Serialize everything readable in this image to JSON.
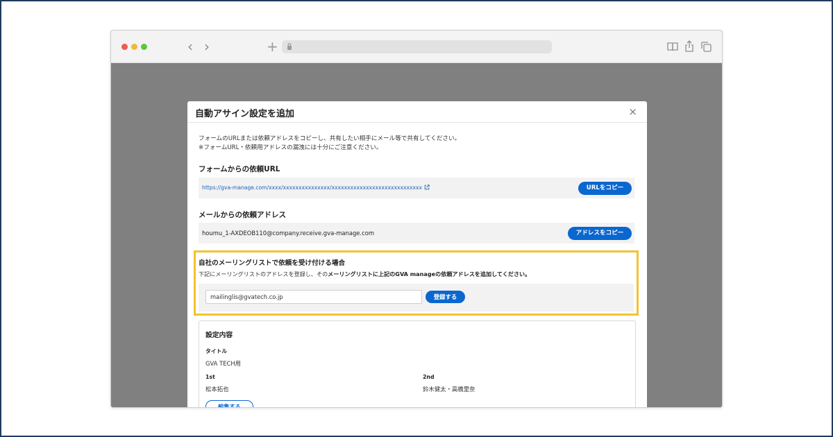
{
  "modal": {
    "title": "自動アサイン設定を追加",
    "close_label": "×",
    "intro_line1": "フォームのURLまたは依頼アドレスをコピーし、共有したい相手にメール等で共有してください。",
    "intro_line2": "※フォームURL・依頼用アドレスの漏洩には十分にご注意ください。"
  },
  "form_url_section": {
    "title": "フォームからの依頼URL",
    "url": "https://gva-manage.com/xxxx/xxxxxxxxxxxxxxx/xxxxxxxxxxxxxxxxxxxxxxxxxxxxx",
    "copy_button": "URLをコピー"
  },
  "mail_section": {
    "title": "メールからの依頼アドレス",
    "address": "houmu_1-AXDEOB110@company.receive.gva-manage.com",
    "copy_button": "アドレスをコピー"
  },
  "mailing_list": {
    "title": "自社のメーリングリストで依頼を受け付ける場合",
    "desc_plain": "下記にメーリングリストのアドレスを登録し、その",
    "desc_bold": "メーリングリストに上記のGVA manageの依頼アドレスを追加してください。",
    "input_value": "mailinglis@gvatech.co.jp",
    "register_button": "登録する"
  },
  "settings": {
    "title": "設定内容",
    "title_label": "タイトル",
    "title_value": "GVA TECH用",
    "first_label": "1st",
    "first_value": "松本拓也",
    "second_label": "2nd",
    "second_value": "鈴木健太・高橋里奈",
    "edit_button": "編集する"
  },
  "icons": {
    "nav_back": "chevron-left-icon",
    "nav_forward": "chevron-right-icon",
    "new_tab": "plus-icon",
    "lock": "lock-icon",
    "reader": "book-icon",
    "share": "share-icon",
    "tabs": "tabs-icon",
    "external_link": "external-link-icon"
  },
  "colors": {
    "primary_button": "#0a67cf",
    "link": "#1a63b8",
    "highlight_border": "#f3c22f",
    "overlay": "#808080",
    "frame_border": "#1f3a5f"
  }
}
